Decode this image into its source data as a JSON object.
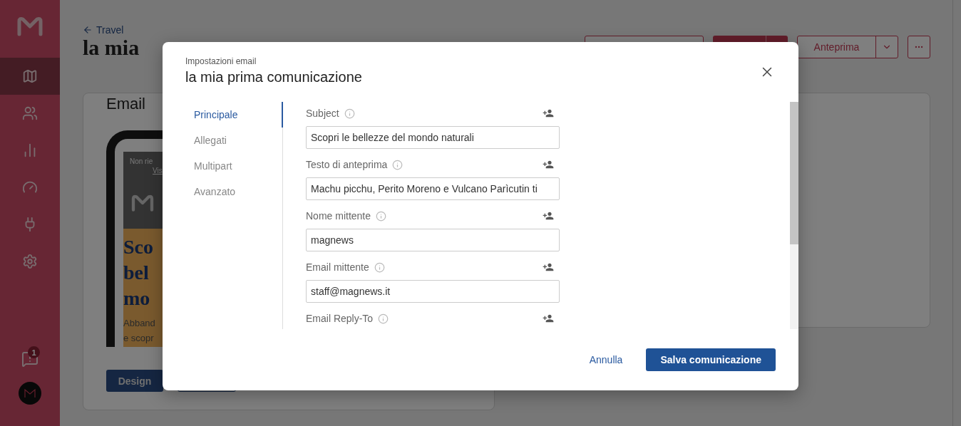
{
  "sidebar": {
    "items": [
      {
        "kind": "map",
        "selected": true
      },
      {
        "kind": "users",
        "selected": false
      },
      {
        "kind": "chart",
        "selected": false
      },
      {
        "kind": "gauge",
        "selected": false
      },
      {
        "kind": "plug",
        "selected": false
      },
      {
        "kind": "settings",
        "selected": false
      }
    ],
    "notifications": {
      "badge": "1"
    }
  },
  "header": {
    "back_link": "Travel",
    "title": "la mia",
    "preview_button": "Anteprima"
  },
  "email_card": {
    "heading": "Email",
    "preview": {
      "top_text": "Non rie",
      "top_link": "Vis",
      "headline": [
        "Sco",
        "bel",
        "mo"
      ],
      "body": [
        "Abband",
        "e scopr"
      ]
    },
    "design_button": "Design"
  },
  "dialog": {
    "subtitle": "Impostazioni email",
    "title": "la mia prima comunicazione",
    "nav": [
      {
        "label": "Principale",
        "selected": true
      },
      {
        "label": "Allegati",
        "selected": false
      },
      {
        "label": "Multipart",
        "selected": false
      },
      {
        "label": "Avanzato",
        "selected": false
      }
    ],
    "fields": [
      {
        "label": "Subject",
        "value": "Scopri le bellezze del mondo naturali"
      },
      {
        "label": "Testo di anteprima",
        "value": "Machu picchu, Perito Moreno e Vulcano Parìcutin ti"
      },
      {
        "label": "Nome mittente",
        "value": "magnews"
      },
      {
        "label": "Email mittente",
        "value": "staff@magnews.it"
      },
      {
        "label": "Email Reply-To"
      }
    ],
    "footer": {
      "cancel": "Annulla",
      "save": "Salva comunicazione"
    }
  }
}
